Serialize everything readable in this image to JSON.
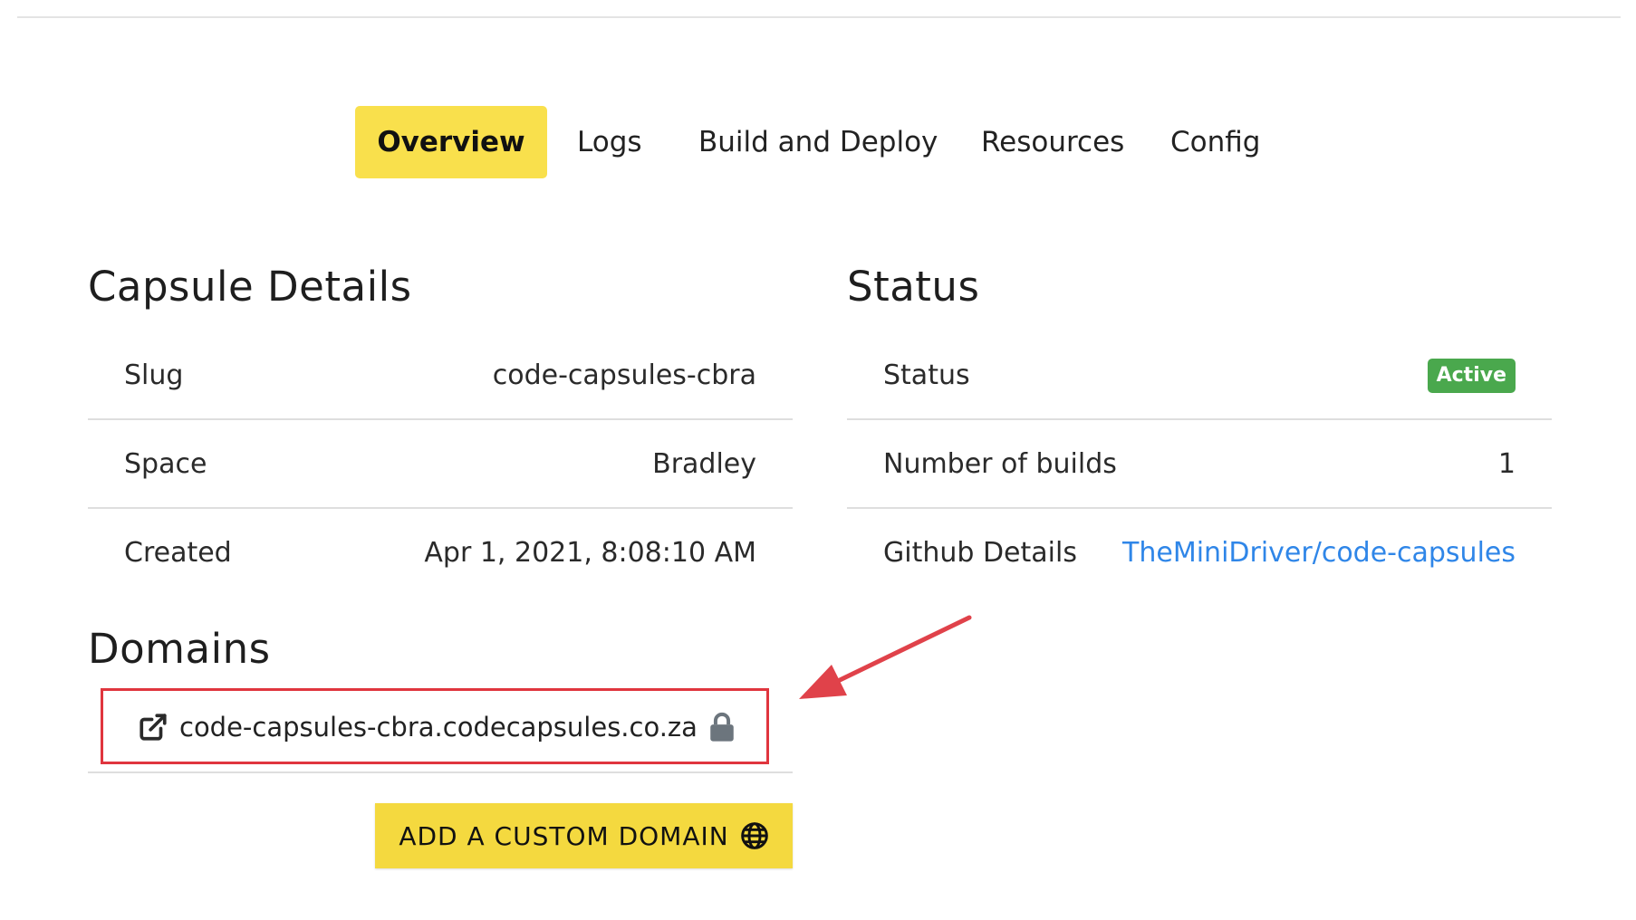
{
  "tabs": [
    {
      "label": "Overview",
      "active": true
    },
    {
      "label": "Logs",
      "active": false
    },
    {
      "label": "Build and Deploy",
      "active": false
    },
    {
      "label": "Resources",
      "active": false
    },
    {
      "label": "Config",
      "active": false
    }
  ],
  "capsule_details": {
    "title": "Capsule Details",
    "rows": [
      {
        "label": "Slug",
        "value": "code-capsules-cbra"
      },
      {
        "label": "Space",
        "value": "Bradley"
      },
      {
        "label": "Created",
        "value": "Apr 1, 2021, 8:08:10 AM"
      }
    ]
  },
  "status": {
    "title": "Status",
    "rows": [
      {
        "label": "Status",
        "badge": "Active"
      },
      {
        "label": "Number of builds",
        "value": "1"
      },
      {
        "label": "Github Details",
        "link": "TheMiniDriver/code-capsules"
      }
    ]
  },
  "domains": {
    "title": "Domains",
    "items": [
      {
        "domain": "code-capsules-cbra.codecapsules.co.za"
      }
    ],
    "add_button_label": "ADD A CUSTOM DOMAIN"
  },
  "icons": {
    "external_link": "external-link-icon",
    "lock": "lock-icon",
    "globe": "globe-icon"
  },
  "colors": {
    "tab_active_bg": "#f9e04c",
    "badge_active": "#4aa84d",
    "link": "#2f86e8",
    "highlight": "#e0353e",
    "button_bg": "#f4d93f"
  }
}
